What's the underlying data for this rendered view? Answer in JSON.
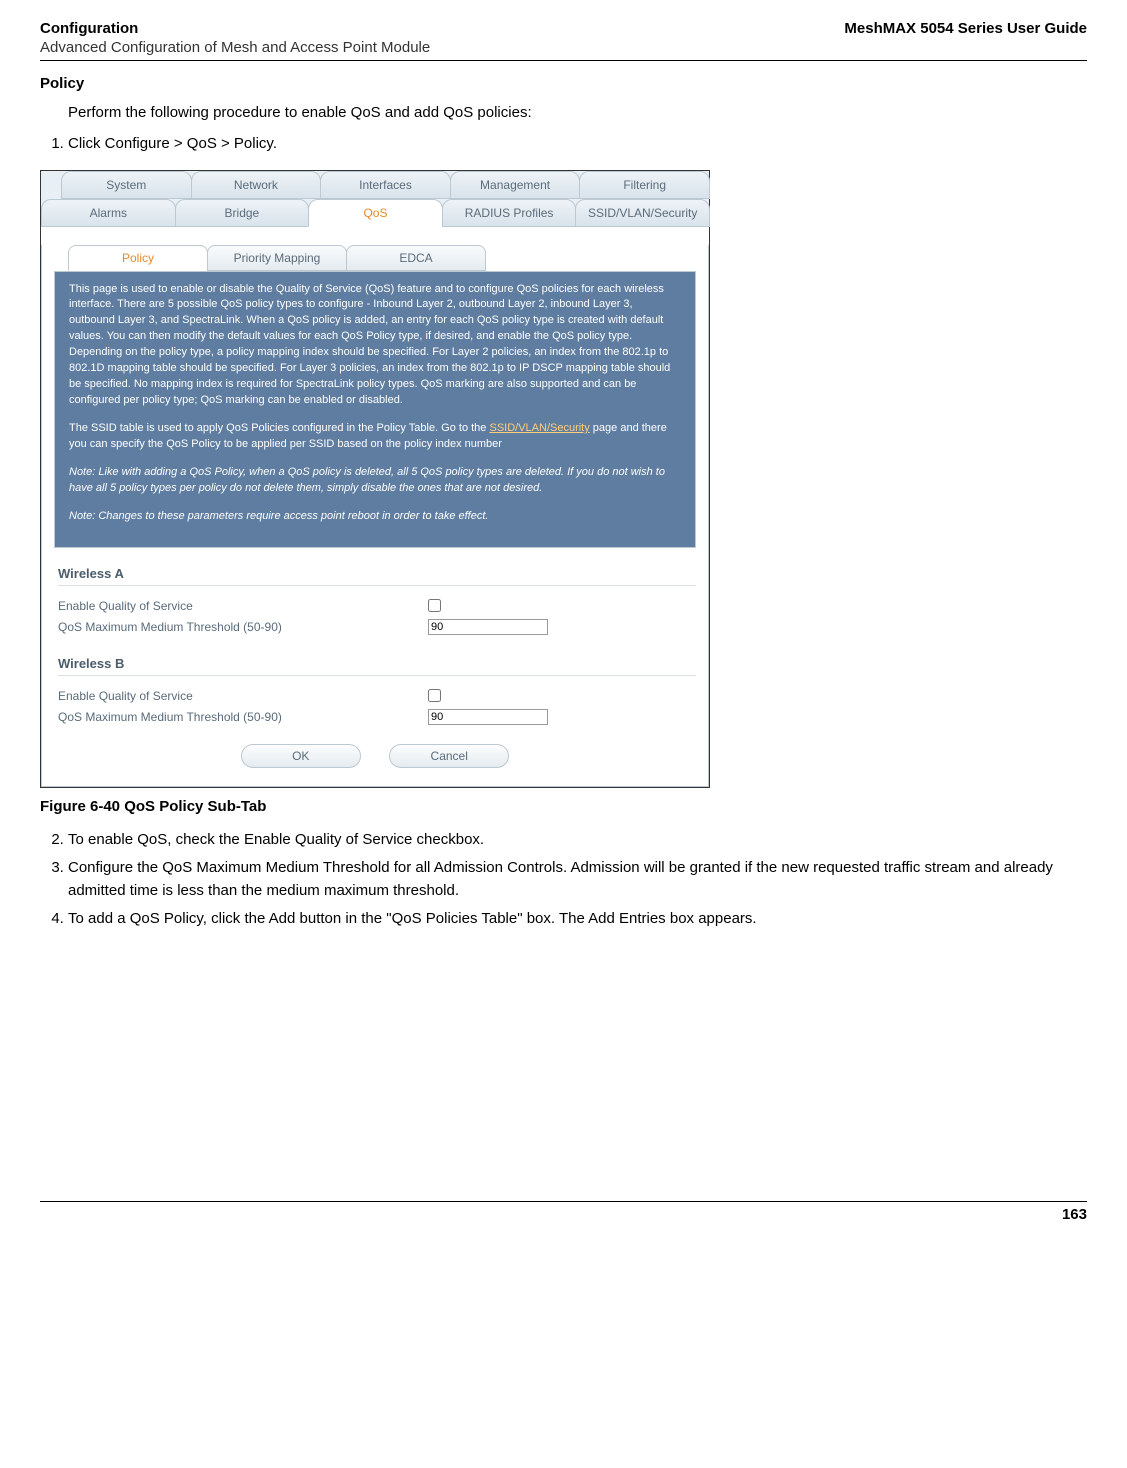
{
  "header": {
    "left": "Configuration",
    "right": "MeshMAX 5054 Series User Guide",
    "sub": "Advanced Configuration of Mesh and Access Point Module"
  },
  "policy_heading": "Policy",
  "intro_text": "Perform the following procedure to enable QoS and add QoS policies:",
  "step1_prefix": "Click ",
  "step1_bold": "Configure > QoS > Policy",
  "step1_suffix": ".",
  "tabs_row1": [
    "System",
    "Network",
    "Interfaces",
    "Management",
    "Filtering"
  ],
  "tabs_row2": [
    "Alarms",
    "Bridge",
    "QoS",
    "RADIUS Profiles",
    "SSID/VLAN/Security"
  ],
  "subtabs": [
    "Policy",
    "Priority Mapping",
    "EDCA"
  ],
  "info": {
    "p1": "This page is used to enable or disable the Quality of Service (QoS) feature and to configure QoS policies for each wireless interface. There are 5 possible QoS policy types to configure - Inbound Layer 2, outbound Layer 2, inbound Layer 3, outbound Layer 3, and SpectraLink. When a QoS policy is added, an entry for each QoS policy type is created with default values. You can then modify the default values for each QoS Policy type, if desired, and enable the QoS policy type. Depending on the policy type, a policy mapping index should be specified. For Layer 2 policies, an index from the 802.1p to 802.1D mapping table should be specified. For Layer 3 policies, an index from the 802.1p to IP DSCP mapping table should be specified. No mapping index is required for SpectraLink policy types. QoS marking are also supported and can be configured per policy type; QoS marking can be enabled or disabled.",
    "p2a": "The SSID table is used to apply QoS Policies configured in the Policy Table. Go to the ",
    "p2_link": "SSID/VLAN/Security",
    "p2b": " page and there you can specify the QoS Policy to be applied per SSID based on the policy index number",
    "note1": "Note: Like with adding a QoS Policy, when a QoS policy is deleted, all 5 QoS policy types are deleted. If you do not wish to have all 5 policy types per policy do not delete them, simply disable the ones that are not desired.",
    "note2": "Note: Changes to these parameters require access point reboot in order to take effect."
  },
  "wirelessA": {
    "title": "Wireless A",
    "enable_label": "Enable Quality of Service",
    "threshold_label": "QoS Maximum Medium Threshold (50-90)",
    "threshold_value": "90"
  },
  "wirelessB": {
    "title": "Wireless B",
    "enable_label": "Enable Quality of Service",
    "threshold_label": "QoS Maximum Medium Threshold (50-90)",
    "threshold_value": "90"
  },
  "buttons": {
    "ok": "OK",
    "cancel": "Cancel"
  },
  "figure_caption": "Figure 6-40 QoS Policy Sub-Tab",
  "step2_a": "To enable QoS, check the ",
  "step2_bold": "Enable Quality of Service",
  "step2_b": " checkbox.",
  "step3_a": "Configure the ",
  "step3_bold": "QoS Maximum Medium Threshold",
  "step3_b": " for all Admission Controls. Admission will be granted if the new requested traffic stream and already admitted time is less than the ",
  "step3_italic": "medium maximum threshold",
  "step3_c": ".",
  "step4_a": "To add a QoS Policy, click the ",
  "step4_bold": "Add",
  "step4_b": " button in the \"QoS Policies Table\" box. The Add Entries box appears.",
  "page_number": "163"
}
